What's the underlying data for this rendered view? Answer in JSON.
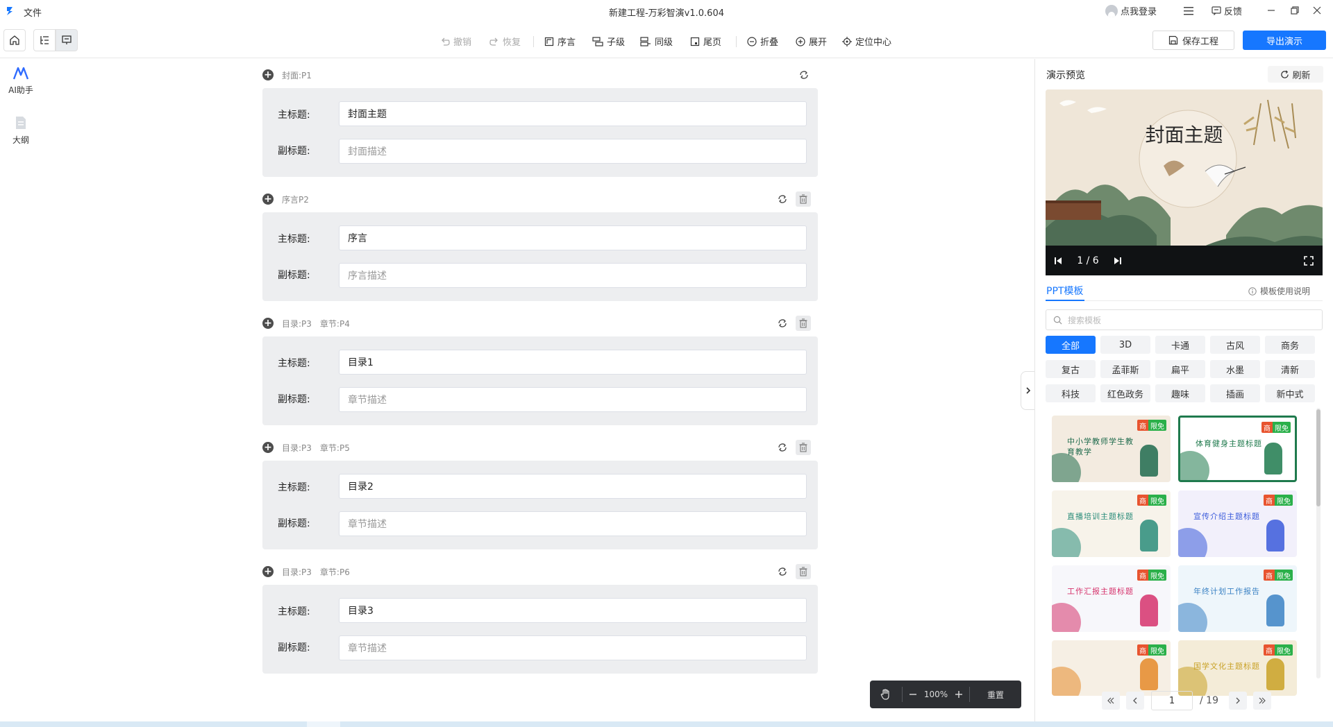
{
  "titlebar": {
    "file_menu": "文件",
    "window_title": "新建工程-万彩智演v1.0.604",
    "login": "点我登录",
    "feedback": "反馈"
  },
  "toolbar": {
    "undo": "撤销",
    "redo": "恢复",
    "preface": "序言",
    "child": "子级",
    "sibling": "同级",
    "ending": "尾页",
    "collapse": "折叠",
    "expand": "展开",
    "locate_center": "定位中心",
    "save_project": "保存工程",
    "export_presentation": "导出演示"
  },
  "left_rail": {
    "ai_assistant": "AI助手",
    "outline": "大纲"
  },
  "labels": {
    "main_title": "主标题:",
    "subtitle": "副标题:"
  },
  "sections": [
    {
      "header_a": "封面:P1",
      "header_b": "",
      "title": "封面主题",
      "subtitle_placeholder": "封面描述",
      "deletable": false
    },
    {
      "header_a": "序言P2",
      "header_b": "",
      "title": "序言",
      "subtitle_placeholder": "序言描述",
      "deletable": true
    },
    {
      "header_a": "目录:P3",
      "header_b": "章节:P4",
      "title": "目录1",
      "subtitle_placeholder": "章节描述",
      "deletable": true
    },
    {
      "header_a": "目录:P3",
      "header_b": "章节:P5",
      "title": "目录2",
      "subtitle_placeholder": "章节描述",
      "deletable": true
    },
    {
      "header_a": "目录:P3",
      "header_b": "章节:P6",
      "title": "目录3",
      "subtitle_placeholder": "章节描述",
      "deletable": true
    }
  ],
  "zoom": {
    "level": "100%",
    "reset": "重置"
  },
  "preview": {
    "title": "演示预览",
    "refresh": "刷新",
    "slide_title": "封面主题",
    "slide_counter": "1 / 6"
  },
  "templates": {
    "tab": "PPT模板",
    "help": "模板使用说明",
    "search_placeholder": "搜索模板",
    "categories": [
      "全部",
      "3D",
      "卡通",
      "古风",
      "商务",
      "复古",
      "孟菲斯",
      "扁平",
      "水墨",
      "清新",
      "科技",
      "红色政务",
      "趣味",
      "插画",
      "新中式"
    ],
    "active_category": "全部",
    "badge_commercial": "商",
    "badge_free": "限免",
    "cards": [
      {
        "text": "中小学教师学生教育教学",
        "bg": "#f3ebe0",
        "accent": "#1f6b4d"
      },
      {
        "text": "体育健身主题标题",
        "bg": "#ffffff",
        "accent": "#1f7a4d"
      },
      {
        "text": "直播培训主题标题",
        "bg": "#f7f3ea",
        "accent": "#2a8c7a"
      },
      {
        "text": "宣传介绍主题标题",
        "bg": "#f2f0fb",
        "accent": "#3b5bdb"
      },
      {
        "text": "工作汇报主题标题",
        "bg": "#f7f7fb",
        "accent": "#d6336c"
      },
      {
        "text": "年终计划工作报告",
        "bg": "#eef6fb",
        "accent": "#3b82c4"
      },
      {
        "text": "",
        "bg": "#f6efe4",
        "accent": "#e58a2a"
      },
      {
        "text": "国学文化主题标题",
        "bg": "#f4ecd8",
        "accent": "#c9a227"
      }
    ],
    "page_current": "1",
    "page_total": "/ 19"
  },
  "colors": {
    "accent": "#1677ff",
    "badge_commercial": "#e8542f",
    "badge_free": "#2bb04a"
  }
}
